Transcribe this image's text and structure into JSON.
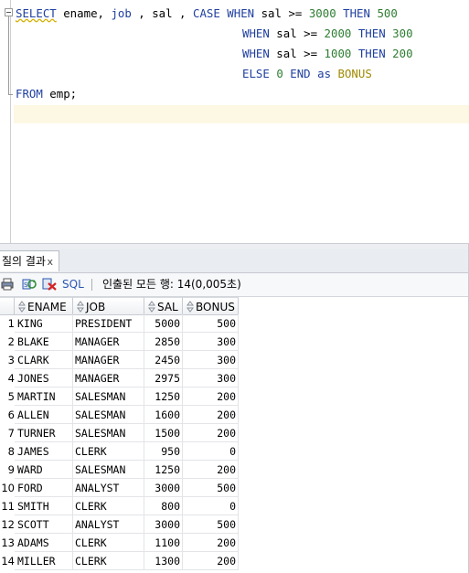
{
  "editor": {
    "lines": [
      {
        "kw1": "SELECT",
        "t1": " ename, ",
        "kw2": "job",
        "t2": " , sal , ",
        "kw3": "CASE",
        "t3": " ",
        "kw4": "WHEN",
        "t4": " sal >= ",
        "n1": "3000",
        "t5": " ",
        "kw5": "THEN",
        "t6": " ",
        "n2": "500"
      },
      {
        "kw1": "WHEN",
        "t1": " sal >= ",
        "n1": "2000",
        "t2": " ",
        "kw2": "THEN",
        "t3": " ",
        "n2": "300"
      },
      {
        "kw1": "WHEN",
        "t1": " sal >= ",
        "n1": "1000",
        "t2": " ",
        "kw2": "THEN",
        "t3": " ",
        "n2": "200"
      },
      {
        "kw1": "ELSE",
        "t1": " ",
        "n1": "0",
        "t2": " ",
        "kw2": "END",
        "t3": " ",
        "kw3": "as",
        "t4": " ",
        "alias": "BONUS"
      },
      {
        "kw1": "FROM",
        "t1": " emp;"
      }
    ]
  },
  "results": {
    "tab_label": "질의 결과",
    "tab_close": "x",
    "sql_label": "SQL",
    "status_text": "인출된 모든 행: 14(0,005초)",
    "columns": [
      "ENAME",
      "JOB",
      "SAL",
      "BONUS"
    ],
    "rows": [
      {
        "num": "1",
        "ename": "KING",
        "job": "PRESIDENT",
        "sal": "5000",
        "bonus": "500"
      },
      {
        "num": "2",
        "ename": "BLAKE",
        "job": "MANAGER",
        "sal": "2850",
        "bonus": "300"
      },
      {
        "num": "3",
        "ename": "CLARK",
        "job": "MANAGER",
        "sal": "2450",
        "bonus": "300"
      },
      {
        "num": "4",
        "ename": "JONES",
        "job": "MANAGER",
        "sal": "2975",
        "bonus": "300"
      },
      {
        "num": "5",
        "ename": "MARTIN",
        "job": "SALESMAN",
        "sal": "1250",
        "bonus": "200"
      },
      {
        "num": "6",
        "ename": "ALLEN",
        "job": "SALESMAN",
        "sal": "1600",
        "bonus": "200"
      },
      {
        "num": "7",
        "ename": "TURNER",
        "job": "SALESMAN",
        "sal": "1500",
        "bonus": "200"
      },
      {
        "num": "8",
        "ename": "JAMES",
        "job": "CLERK",
        "sal": "950",
        "bonus": "0"
      },
      {
        "num": "9",
        "ename": "WARD",
        "job": "SALESMAN",
        "sal": "1250",
        "bonus": "200"
      },
      {
        "num": "10",
        "ename": "FORD",
        "job": "ANALYST",
        "sal": "3000",
        "bonus": "500"
      },
      {
        "num": "11",
        "ename": "SMITH",
        "job": "CLERK",
        "sal": "800",
        "bonus": "0"
      },
      {
        "num": "12",
        "ename": "SCOTT",
        "job": "ANALYST",
        "sal": "3000",
        "bonus": "500"
      },
      {
        "num": "13",
        "ename": "ADAMS",
        "job": "CLERK",
        "sal": "1100",
        "bonus": "200"
      },
      {
        "num": "14",
        "ename": "MILLER",
        "job": "CLERK",
        "sal": "1300",
        "bonus": "200"
      }
    ]
  },
  "colors": {
    "keyword": "#1f3fa0",
    "number": "#2e7d32",
    "alias": "#a08a00",
    "current_line": "#fdf8e3"
  }
}
